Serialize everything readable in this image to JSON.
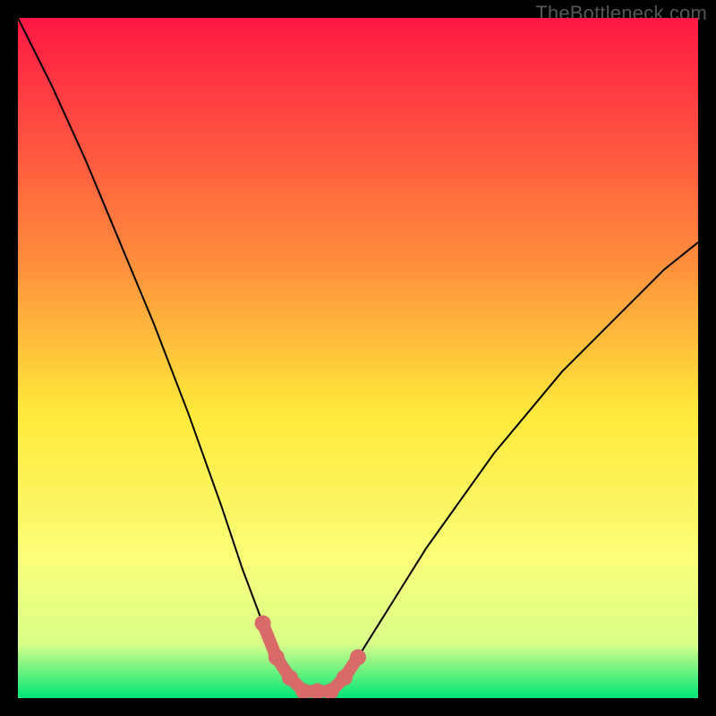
{
  "watermark": "TheBottleneck.com",
  "colors": {
    "frame": "#000000",
    "curve": "#000000",
    "marker": "#d86a6a",
    "gradient_top": "#ff1744",
    "gradient_mid_upper": "#ff8a3d",
    "gradient_mid": "#ffe93b",
    "gradient_mid_lower": "#f9ff7a",
    "gradient_low": "#d9ff8a",
    "gradient_bottom": "#00e676"
  },
  "chart_data": {
    "type": "line",
    "title": "",
    "xlabel": "",
    "ylabel": "",
    "xlim": [
      0,
      100
    ],
    "ylim": [
      0,
      100
    ],
    "grid": false,
    "legend": false,
    "series": [
      {
        "name": "bottleneck-curve",
        "x": [
          0,
          5,
          10,
          15,
          20,
          25,
          30,
          33,
          36,
          38,
          40,
          42,
          44,
          46,
          48,
          50,
          55,
          60,
          65,
          70,
          75,
          80,
          85,
          90,
          95,
          100
        ],
        "values": [
          100,
          90,
          79,
          67,
          55,
          42,
          28,
          19,
          11,
          6,
          3,
          1,
          1,
          1,
          3,
          6,
          14,
          22,
          29,
          36,
          42,
          48,
          53,
          58,
          63,
          67
        ]
      }
    ],
    "highlight_region": {
      "name": "optimal-trough",
      "x": [
        36,
        38,
        40,
        42,
        44,
        46,
        48,
        50
      ],
      "values": [
        11,
        6,
        3,
        1,
        1,
        1,
        3,
        6
      ]
    }
  }
}
